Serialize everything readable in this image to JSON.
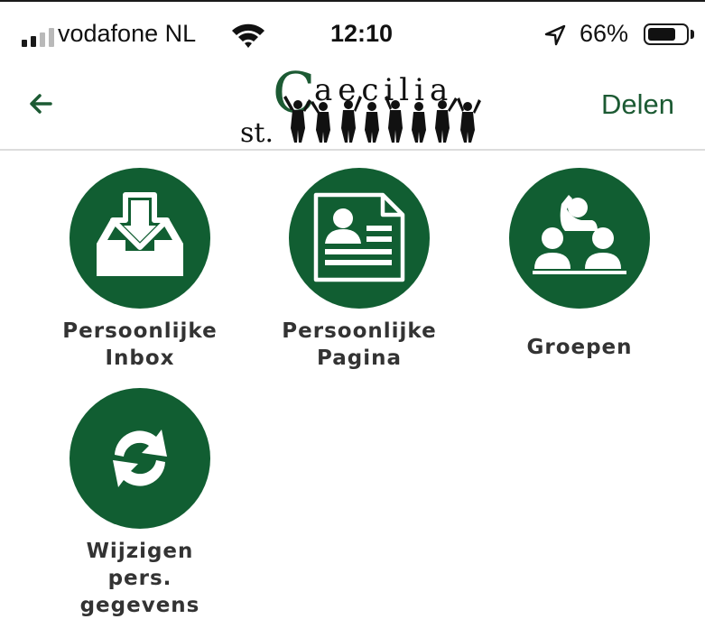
{
  "status_bar": {
    "carrier": "vodafone NL",
    "time": "12:10",
    "battery_percent": "66%",
    "battery_level": 0.66,
    "signal_bars": 4,
    "signal_active": 2,
    "icons": [
      "signal-icon",
      "wifi-icon",
      "location-arrow-icon",
      "battery-icon"
    ]
  },
  "nav": {
    "back_icon": "arrow-left-icon",
    "logo": {
      "prefix": "st.",
      "initial": "C",
      "rest": "aecilia"
    },
    "share_label": "Delen"
  },
  "colors": {
    "brand_green": "#115e32",
    "text_dark": "#333333"
  },
  "tiles": [
    {
      "label": "Persoonlijke\nInbox",
      "icon": "inbox-download-icon"
    },
    {
      "label": "Persoonlijke\nPagina",
      "icon": "profile-page-icon"
    },
    {
      "label": "Groepen",
      "icon": "group-icon"
    },
    {
      "label": "Wijzigen\npers. gegevens",
      "icon": "refresh-icon"
    }
  ]
}
